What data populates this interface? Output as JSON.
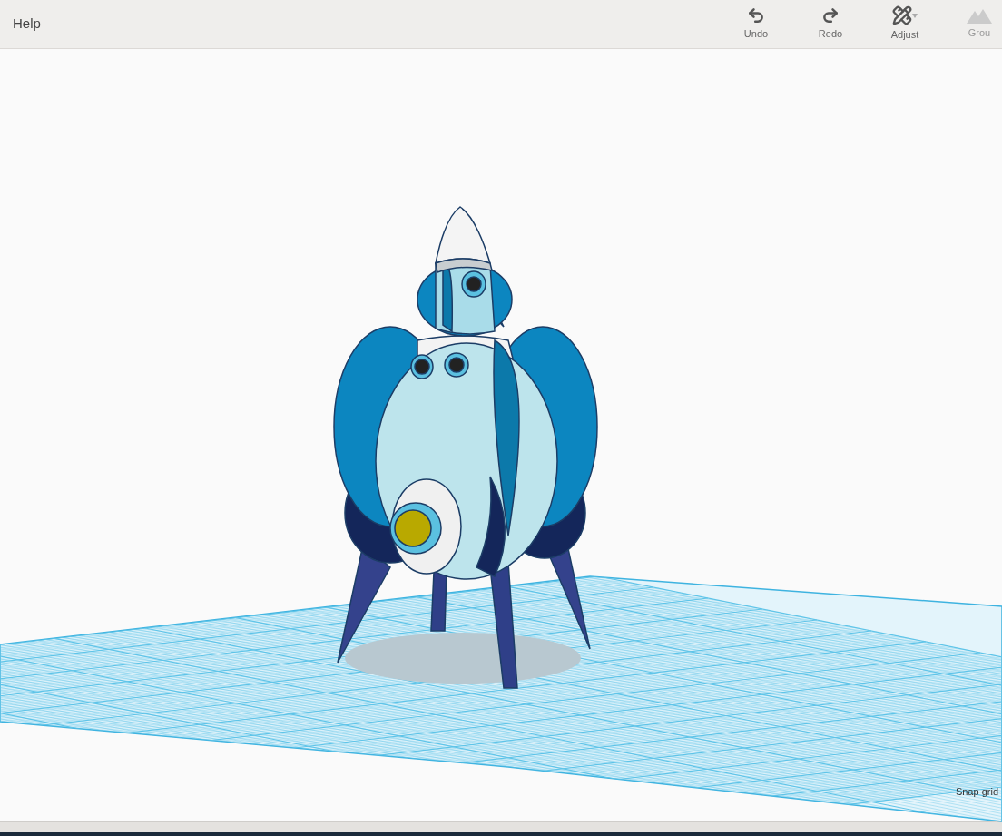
{
  "toolbar": {
    "help": "Help",
    "tools": [
      {
        "kind": "undo",
        "label": "Undo",
        "disabled": false
      },
      {
        "kind": "redo",
        "label": "Redo",
        "disabled": false
      },
      {
        "kind": "adjust",
        "label": "Adjust",
        "disabled": false
      },
      {
        "kind": "group",
        "label": "Grou",
        "disabled": true
      }
    ]
  },
  "canvas": {
    "snap_grid": "Snap grid"
  }
}
